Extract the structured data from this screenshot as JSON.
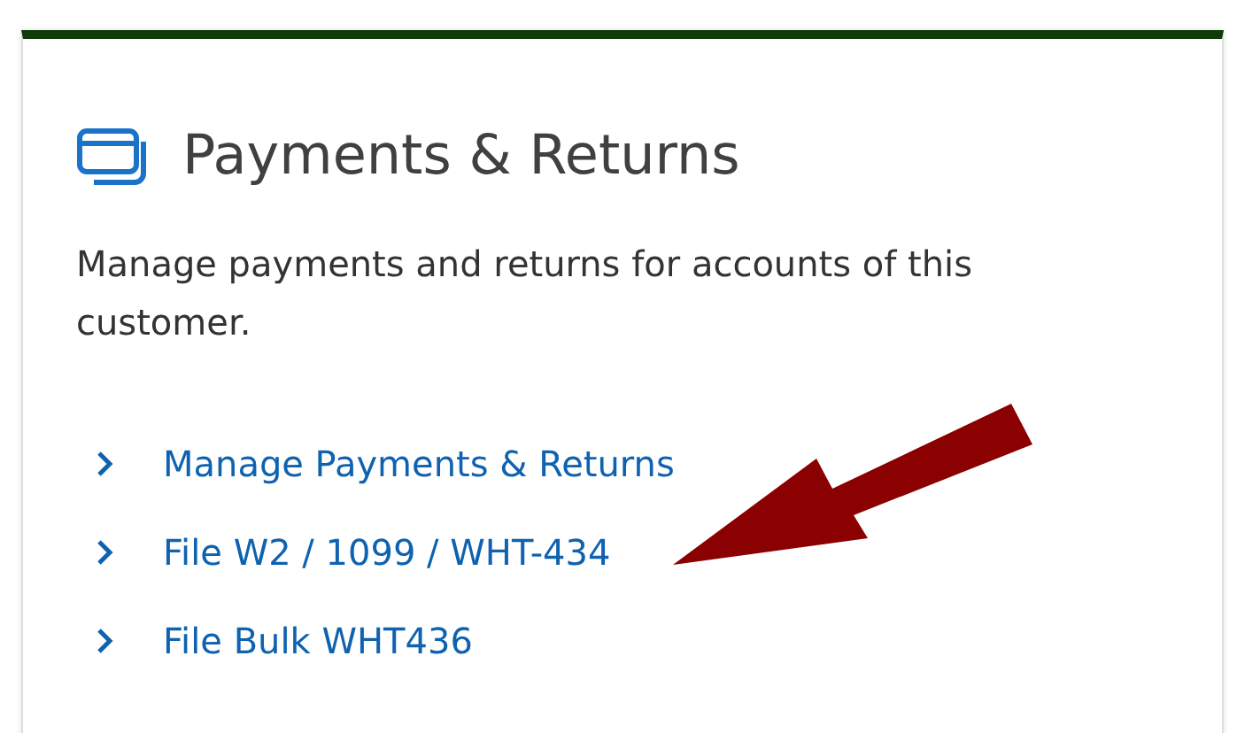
{
  "card": {
    "title": "Payments & Returns",
    "description": "Manage payments and returns for accounts of this customer.",
    "links": [
      {
        "label": "Manage Payments & Returns"
      },
      {
        "label": "File W2 / 1099 / WHT-434"
      },
      {
        "label": "File Bulk WHT436"
      }
    ]
  }
}
